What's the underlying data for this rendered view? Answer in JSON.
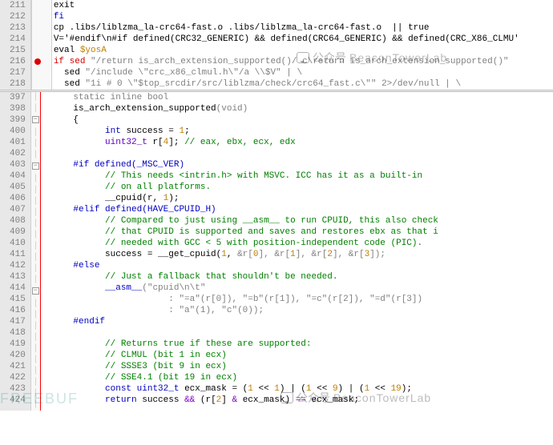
{
  "top": {
    "lines": [
      211,
      212,
      213,
      214,
      215,
      216,
      217,
      218
    ],
    "rows": [
      {
        "txt": "exit ",
        "tail": "",
        "cls": ""
      },
      {
        "txt": "fi",
        "cls": "kw"
      },
      {
        "txt": "cp .libs/liblzma_la-crc64-fast.o .libs/liblzma_la-crc64-fast.o  || true"
      },
      {
        "txt": "V='#endif\\n#if defined(CRC32_GENERIC) && defined(CRC64_GENERIC) && defined(CRC_X86_CLMU'"
      },
      {
        "txt": "eval ",
        "tail": "$yosA",
        "tailCls": "var"
      },
      {
        "pref": "if sed ",
        "str": "\"/return is_arch_extension_supported()/ c\\return is_arch_extension_supported()\"",
        "highlight": true
      },
      {
        "pref": "  sed ",
        "str": "\"/include \\\"crc_x86_clmul.h\\\"/a \\\\$V\" | \\"
      },
      {
        "pref": "  sed ",
        "str": "\"1i # 0 \\\"$top_srcdir/src/liblzma/check/crc64_fast.c\\\"\" 2>/dev/null | \\"
      }
    ],
    "marker_line": 216
  },
  "bottom": {
    "lines": [
      397,
      398,
      399,
      400,
      401,
      402,
      403,
      404,
      405,
      406,
      407,
      408,
      409,
      410,
      411,
      412,
      413,
      414,
      415,
      416,
      417,
      418,
      419,
      420,
      421,
      422,
      423,
      424
    ],
    "fn_name": "is_arch_extension_supported",
    "fn_sig_tail": "(void)",
    "decl_success": "int",
    "success_val": "1",
    "decl_r": "uint32_t",
    "r_size": "4",
    "r_cmt": "// eax, ebx, ecx, edx",
    "pp1": "#if defined(_MSC_VER)",
    "c1a": "// This needs <intrin.h> with MSVC. ICC has it as a built-in",
    "c1b": "// on all platforms.",
    "cpuid": "__cpuid(r, ",
    "cpuid_n": "1",
    "pp2": "#elif defined(HAVE_CPUID_H)",
    "c2a": "// Compared to just using __asm__ to run CPUID, this also check",
    "c2b": "// that CPUID is supported and saves and restores ebx as that i",
    "c2c": "// needed with GCC < 5 with position-independent code (PIC).",
    "gcpuid_pre": "success = __get_cpuid(",
    "gcpuid_args": [
      "1",
      "&r[0]",
      "&r[1]",
      "&r[2]",
      "&r[3]"
    ],
    "pp3": "#else",
    "c3": "// Just a fallback that shouldn't be needed.",
    "asm_lead": "__asm__",
    "asm_body": "(\"cpuid\\n\\t\"",
    "asm_out": ": \"=a\"(r[0]), \"=b\"(r[1]), \"=c\"(r[2]), \"=d\"(r[3])",
    "asm_in": ": \"a\"(1), \"c\"(0));",
    "pp4": "#endif",
    "c4a": "// Returns true if these are supported:",
    "c4b": "// CLMUL (bit 1 in ecx)",
    "c4c": "// SSSE3 (bit 9 in ecx)",
    "c4d": "// SSE4.1 (bit 19 in ecx)",
    "mask_decl": "const uint32_t ecx_mask = (",
    "mask_parts": [
      "1 << 1",
      "1 << 9",
      "1 << 19"
    ],
    "ret": "return success && (r[2] & ecx_mask) == ecx_mask;",
    "fold_minus": [
      399,
      403,
      414
    ],
    "static_inline": "static inline bool"
  },
  "watermark": {
    "label1": "公众号",
    "label2": "BeaconTowerLab"
  }
}
